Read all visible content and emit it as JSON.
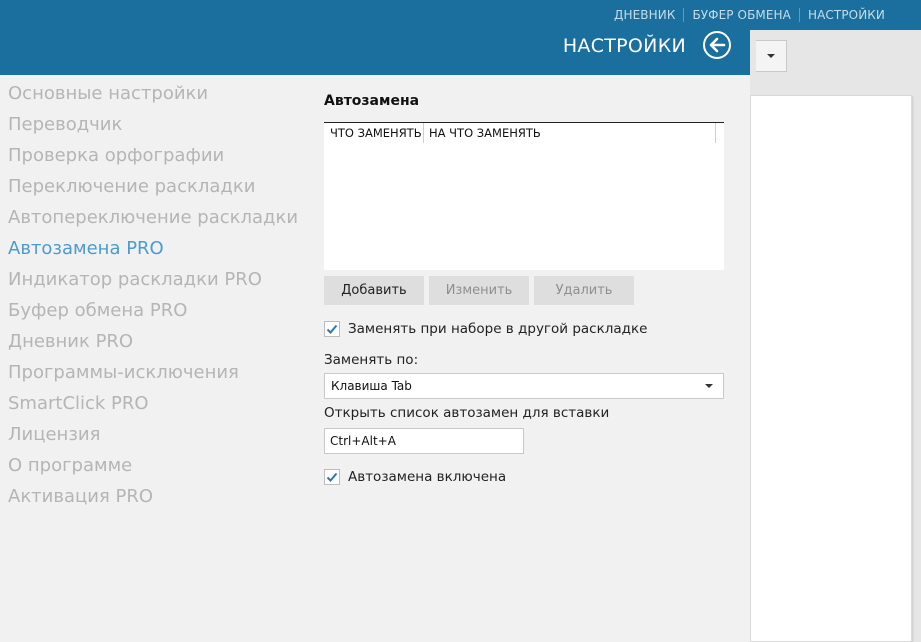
{
  "topnav": [
    "ДНЕВНИК",
    "БУФЕР ОБМЕНА",
    "НАСТРОЙКИ"
  ],
  "settings": {
    "title": "НАСТРОЙКИ",
    "nav": [
      {
        "label": "Основные настройки",
        "active": false
      },
      {
        "label": "Переводчик",
        "active": false
      },
      {
        "label": "Проверка орфографии",
        "active": false
      },
      {
        "label": "Переключение раскладки",
        "active": false
      },
      {
        "label": "Автопереключение раскладки",
        "active": false
      },
      {
        "label": "Автозамена PRO",
        "active": true
      },
      {
        "label": "Индикатор раскладки PRO",
        "active": false
      },
      {
        "label": "Буфер обмена PRO",
        "active": false
      },
      {
        "label": "Дневник PRO",
        "active": false
      },
      {
        "label": "Программы-исключения",
        "active": false
      },
      {
        "label": "SmartClick PRO",
        "active": false
      },
      {
        "label": "Лицензия",
        "active": false
      },
      {
        "label": "О программе",
        "active": false
      },
      {
        "label": "Активация PRO",
        "active": false
      }
    ]
  },
  "autoreplace": {
    "title": "Автозамена",
    "columns": [
      "ЧТО ЗАМЕНЯТЬ",
      "НА ЧТО ЗАМЕНЯТЬ"
    ],
    "rows": [],
    "buttons": {
      "add": "Добавить",
      "edit": "Изменить",
      "delete": "Удалить"
    },
    "replace_other_layout": {
      "label": "Заменять при наборе в другой раскладке",
      "checked": true
    },
    "replace_by_label": "Заменять по:",
    "replace_by_value": "Клавиша Tab",
    "open_list_label": "Открыть список автозамен для вставки",
    "open_list_hotkey": "Ctrl+Alt+A",
    "enabled": {
      "label": "Автозамена включена",
      "checked": true
    }
  },
  "colors": {
    "header": "#1a6f9e",
    "active_nav": "#4a9ccd",
    "inactive_nav": "#b5b5b5"
  },
  "icons": {
    "back": "arrow-left-circle-icon",
    "check": "checkmark-icon",
    "dropdown": "chevron-down-icon"
  }
}
